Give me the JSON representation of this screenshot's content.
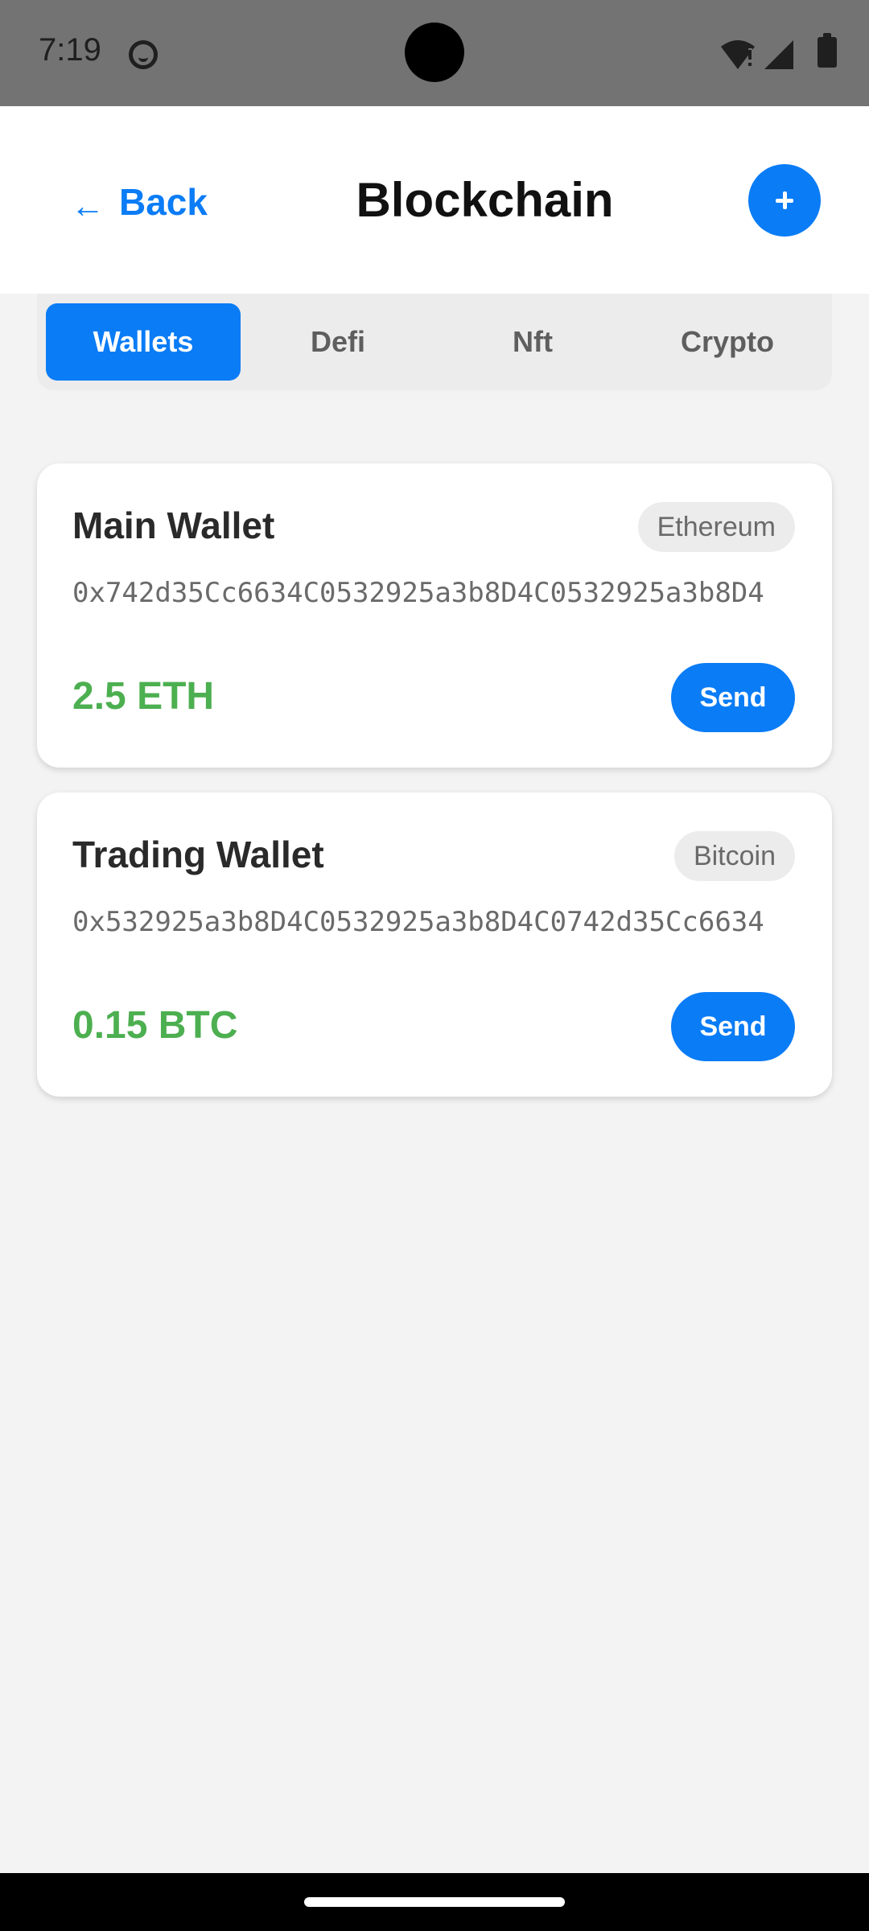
{
  "status_bar": {
    "time": "7:19",
    "icons": [
      "app-notification-icon",
      "wifi-alert-icon",
      "signal-icon",
      "battery-icon"
    ]
  },
  "header": {
    "back_arrow": "←",
    "back_label": "Back",
    "title": "Blockchain",
    "add_icon": "plus-icon"
  },
  "tabs": [
    {
      "label": "Wallets",
      "active": true
    },
    {
      "label": "Defi",
      "active": false
    },
    {
      "label": "Nft",
      "active": false
    },
    {
      "label": "Crypto",
      "active": false
    }
  ],
  "wallets": [
    {
      "name": "Main Wallet",
      "network": "Ethereum",
      "address": "0x742d35Cc6634C0532925a3b8D4C0532925a3b8D4",
      "balance": "2.5 ETH",
      "send_label": "Send"
    },
    {
      "name": "Trading Wallet",
      "network": "Bitcoin",
      "address": "0x532925a3b8D4C0532925a3b8D4C0742d35Cc6634",
      "balance": "0.15 BTC",
      "send_label": "Send"
    }
  ],
  "colors": {
    "accent": "#0a7cf6",
    "balance_green": "#4caf50",
    "status_bar": "#737373",
    "background": "#f3f3f3"
  }
}
